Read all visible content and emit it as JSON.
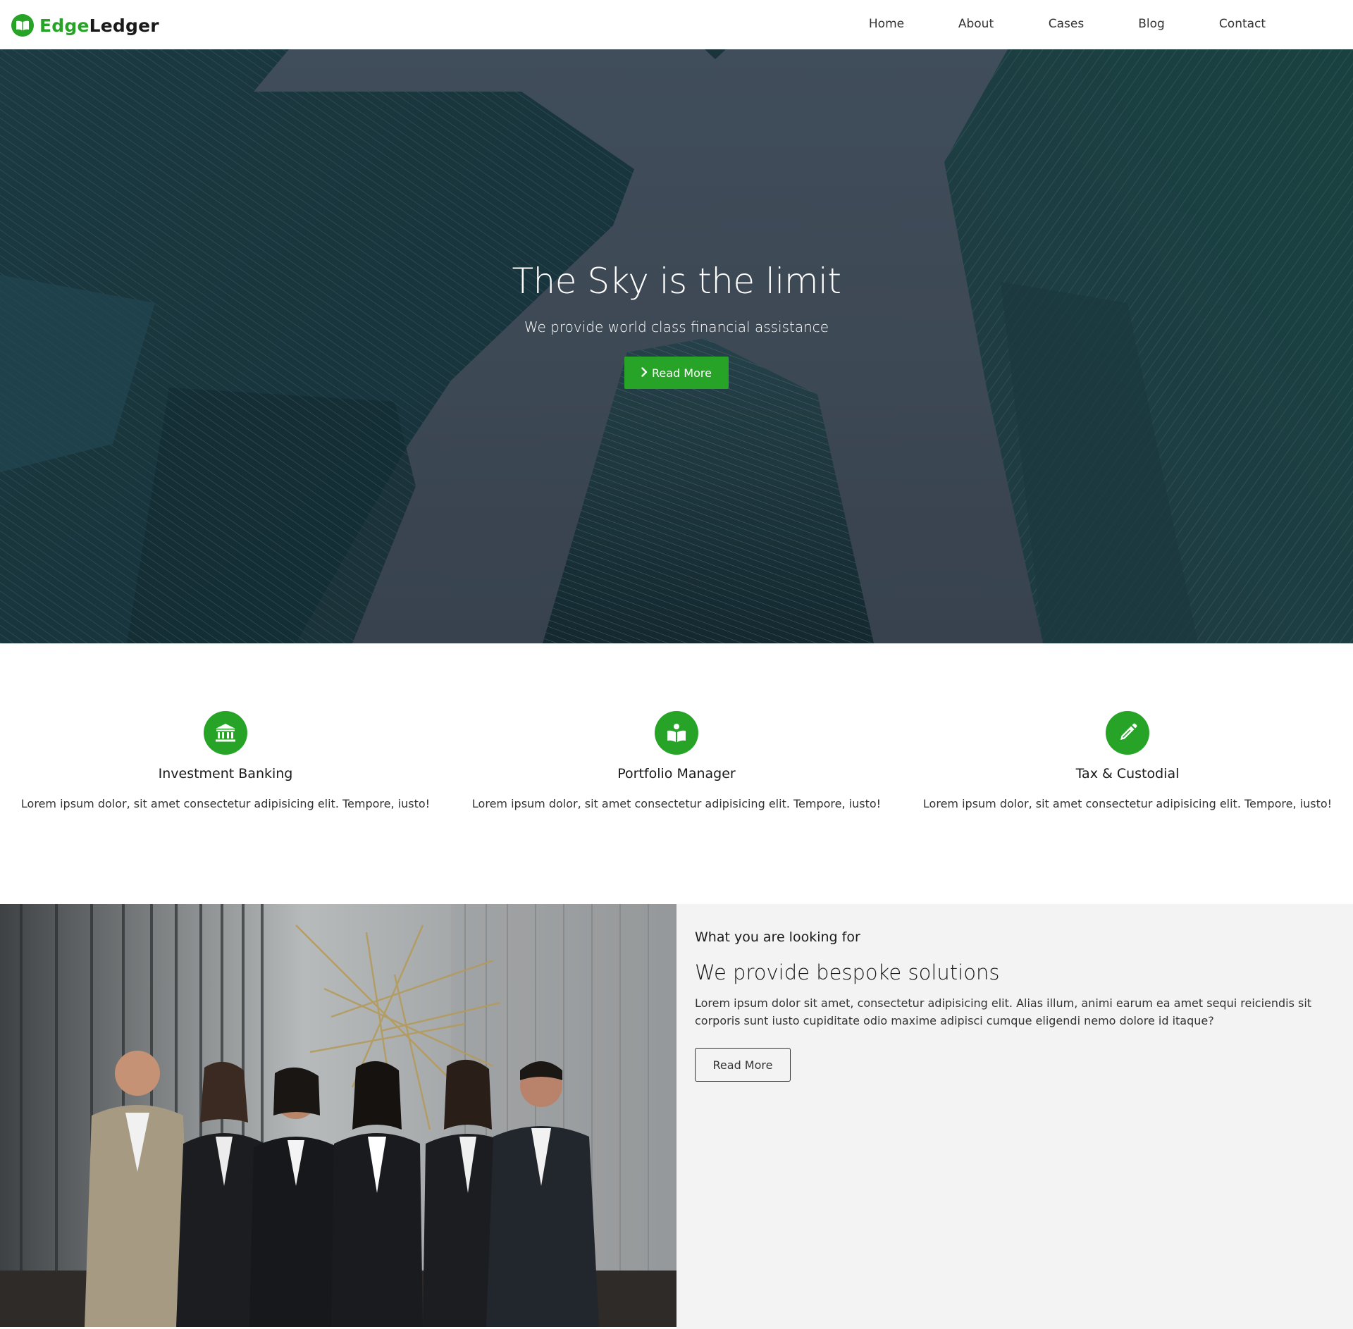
{
  "brand": {
    "name_part1": "Edge",
    "name_part2": "Ledger",
    "accent_color": "#27a327",
    "logo_icon": "open-book-icon"
  },
  "nav": {
    "items": [
      {
        "label": "Home"
      },
      {
        "label": "About"
      },
      {
        "label": "Cases"
      },
      {
        "label": "Blog"
      },
      {
        "label": "Contact"
      }
    ]
  },
  "hero": {
    "title": "The Sky is the limit",
    "subtitle": "We provide world class financial assistance",
    "button_label": "Read More",
    "button_icon": "chevron-right-icon"
  },
  "services": {
    "items": [
      {
        "icon": "bank-icon",
        "title": "Investment Banking",
        "text": "Lorem ipsum dolor, sit amet consectetur adipisicing elit. Tempore, iusto!"
      },
      {
        "icon": "reader-icon",
        "title": "Portfolio Manager",
        "text": "Lorem ipsum dolor, sit amet consectetur adipisicing elit. Tempore, iusto!"
      },
      {
        "icon": "pencil-icon",
        "title": "Tax & Custodial",
        "text": "Lorem ipsum dolor, sit amet consectetur adipisicing elit. Tempore, iusto!"
      }
    ]
  },
  "about": {
    "eyebrow": "What you are looking for",
    "title": "We provide bespoke solutions",
    "text": "Lorem ipsum dolor sit amet, consectetur adipisicing elit. Alias illum, animi earum ea amet sequi reiciendis sit corporis sunt iusto cupiditate odio maxime adipisci cumque eligendi nemo dolore id itaque?",
    "button_label": "Read More"
  }
}
